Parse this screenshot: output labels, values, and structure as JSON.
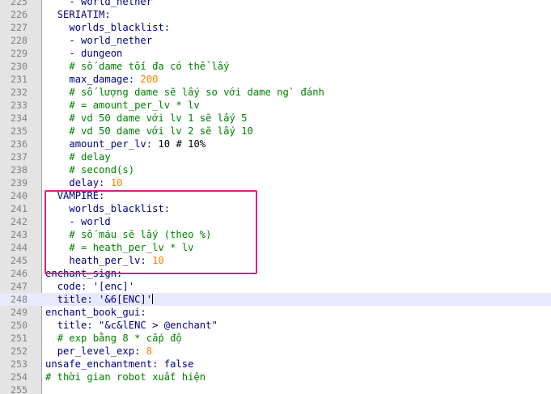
{
  "lines": [
    {
      "n": "225",
      "indent": 4,
      "tokens": [
        {
          "t": "- world_nether",
          "c": "str"
        }
      ]
    },
    {
      "n": "226",
      "indent": 2,
      "tokens": [
        {
          "t": "SERIATIM:",
          "c": "key"
        }
      ]
    },
    {
      "n": "227",
      "indent": 4,
      "tokens": [
        {
          "t": "worlds_blacklist:",
          "c": "key"
        }
      ]
    },
    {
      "n": "228",
      "indent": 4,
      "tokens": [
        {
          "t": "- world_nether",
          "c": "str"
        }
      ]
    },
    {
      "n": "229",
      "indent": 4,
      "tokens": [
        {
          "t": "- dungeon",
          "c": "str"
        }
      ]
    },
    {
      "n": "230",
      "indent": 4,
      "tokens": [
        {
          "t": "# số dame tối đa có thể lấy",
          "c": "cmt"
        }
      ]
    },
    {
      "n": "231",
      "indent": 4,
      "tokens": [
        {
          "t": "max_damage:",
          "c": "key"
        },
        {
          "t": " 200",
          "c": "num"
        }
      ]
    },
    {
      "n": "232",
      "indent": 4,
      "tokens": [
        {
          "t": "# số lượng dame sẽ lấy so với dame ng` đánh",
          "c": "cmt"
        }
      ]
    },
    {
      "n": "233",
      "indent": 4,
      "tokens": [
        {
          "t": "# = amount_per_lv * lv",
          "c": "cmt"
        }
      ]
    },
    {
      "n": "234",
      "indent": 4,
      "tokens": [
        {
          "t": "# vd 50 dame với lv 1 sẽ lấy 5",
          "c": "cmt"
        }
      ]
    },
    {
      "n": "235",
      "indent": 4,
      "tokens": [
        {
          "t": "# vd 50 dame với lv 2 sẽ lấy 10",
          "c": "cmt"
        }
      ]
    },
    {
      "n": "236",
      "indent": 4,
      "tokens": [
        {
          "t": "amount_per_lv:",
          "c": "key"
        },
        {
          "t": " 10 # 10%",
          "c": "plain"
        }
      ]
    },
    {
      "n": "237",
      "indent": 4,
      "tokens": [
        {
          "t": "# delay",
          "c": "cmt"
        }
      ]
    },
    {
      "n": "238",
      "indent": 4,
      "tokens": [
        {
          "t": "# second(s)",
          "c": "cmt"
        }
      ]
    },
    {
      "n": "239",
      "indent": 4,
      "tokens": [
        {
          "t": "delay:",
          "c": "key"
        },
        {
          "t": " 10",
          "c": "num"
        }
      ]
    },
    {
      "n": "240",
      "indent": 2,
      "tokens": [
        {
          "t": "VAMPIRE:",
          "c": "key"
        }
      ]
    },
    {
      "n": "241",
      "indent": 4,
      "tokens": [
        {
          "t": "worlds_blacklist:",
          "c": "key"
        }
      ]
    },
    {
      "n": "242",
      "indent": 4,
      "tokens": [
        {
          "t": "- world",
          "c": "str"
        }
      ]
    },
    {
      "n": "243",
      "indent": 4,
      "tokens": [
        {
          "t": "# số máu sẽ lấy (theo %)",
          "c": "cmt"
        }
      ]
    },
    {
      "n": "244",
      "indent": 4,
      "tokens": [
        {
          "t": "# = heath_per_lv * lv",
          "c": "cmt"
        }
      ]
    },
    {
      "n": "245",
      "indent": 4,
      "tokens": [
        {
          "t": "heath_per_lv:",
          "c": "key"
        },
        {
          "t": " 10",
          "c": "num"
        }
      ]
    },
    {
      "n": "246",
      "indent": 0,
      "tokens": [
        {
          "t": "enchant_sign:",
          "c": "key"
        }
      ]
    },
    {
      "n": "247",
      "indent": 2,
      "tokens": [
        {
          "t": "code:",
          "c": "key"
        },
        {
          "t": " '[enc]'",
          "c": "str"
        }
      ]
    },
    {
      "n": "248",
      "indent": 2,
      "current": true,
      "caret": true,
      "tokens": [
        {
          "t": "title:",
          "c": "key"
        },
        {
          "t": " '&6[ENC]'",
          "c": "str"
        }
      ]
    },
    {
      "n": "249",
      "indent": 0,
      "tokens": [
        {
          "t": "enchant_book_gui:",
          "c": "key"
        }
      ]
    },
    {
      "n": "250",
      "indent": 2,
      "tokens": [
        {
          "t": "title:",
          "c": "key"
        },
        {
          "t": " \"&c&lENC > @enchant\"",
          "c": "str"
        }
      ]
    },
    {
      "n": "251",
      "indent": 2,
      "tokens": [
        {
          "t": "# exp bằng 8 * cấp độ",
          "c": "cmt"
        }
      ]
    },
    {
      "n": "252",
      "indent": 2,
      "tokens": [
        {
          "t": "per_level_exp:",
          "c": "key"
        },
        {
          "t": " 8",
          "c": "num"
        }
      ]
    },
    {
      "n": "253",
      "indent": 0,
      "tokens": [
        {
          "t": "unsafe_enchantment:",
          "c": "key"
        },
        {
          "t": " false",
          "c": "key"
        }
      ]
    },
    {
      "n": "254",
      "indent": 0,
      "tokens": [
        {
          "t": "# thời gian robot xuất hiện",
          "c": "cmt"
        }
      ]
    },
    {
      "n": "255",
      "indent": 0,
      "tokens": []
    }
  ],
  "colors": {
    "highlight_box": "#d4237f",
    "comment": "#008000",
    "key": "#000080",
    "number": "#ff8000",
    "current_line": "#e8e8ff"
  }
}
